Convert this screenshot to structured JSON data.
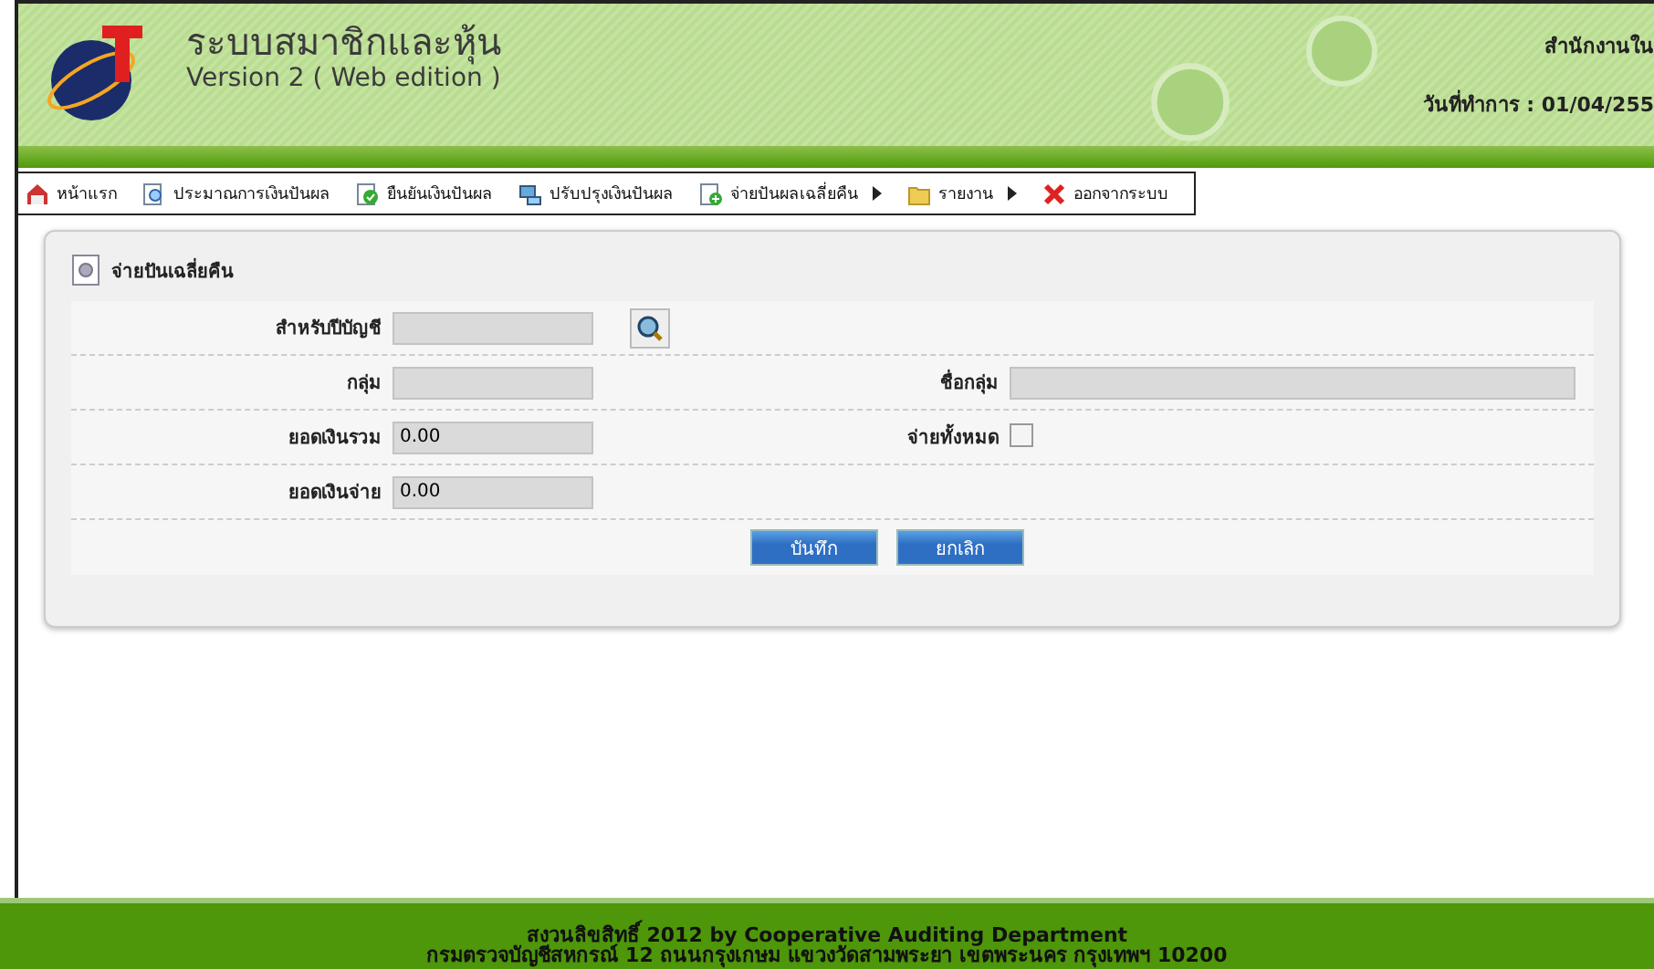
{
  "header": {
    "title": "ระบบสมาชิกและหุ้น",
    "subtitle": "Version 2 ( Web edition )",
    "office": "สำนักงานใน",
    "work_date": "วันที่ทำการ : 01/04/255"
  },
  "menu": [
    {
      "label": "หน้าแรก",
      "has_submenu": false
    },
    {
      "label": "ประมาณการเงินปันผล",
      "has_submenu": false
    },
    {
      "label": "ยืนยันเงินปันผล",
      "has_submenu": false
    },
    {
      "label": "ปรับปรุงเงินปันผล",
      "has_submenu": false
    },
    {
      "label": "จ่ายปันผลเฉลี่ยคืน",
      "has_submenu": true
    },
    {
      "label": "รายงาน",
      "has_submenu": true
    },
    {
      "label": "ออกจากระบบ",
      "has_submenu": false
    }
  ],
  "panel": {
    "title": "จ่ายปันเฉลี่ยคืน",
    "rows": [
      {
        "label": "สำหรับปีบัญชี",
        "value": "",
        "search_button": true
      },
      {
        "label": "กลุ่ม",
        "value": "",
        "right_label": "ชื่อกลุ่ม",
        "right_value": ""
      },
      {
        "label": "ยอดเงินรวม",
        "value": "0.00",
        "right_label": "จ่ายทั้งหมด",
        "right_checked": false
      },
      {
        "label": "ยอดเงินจ่าย",
        "value": "0.00"
      }
    ],
    "buttons": [
      "บันทึก",
      "ยกเลิก"
    ]
  },
  "footer": {
    "line1": "สงวนลิขสิทธิ์ 2012 by Cooperative Auditing Department",
    "line2": "กรมตรวจบัญชีสหกรณ์ 12 ถนนกรุงเกษม แขวงวัดสามพระยา เขตพระนคร กรุงเทพฯ 10200"
  }
}
